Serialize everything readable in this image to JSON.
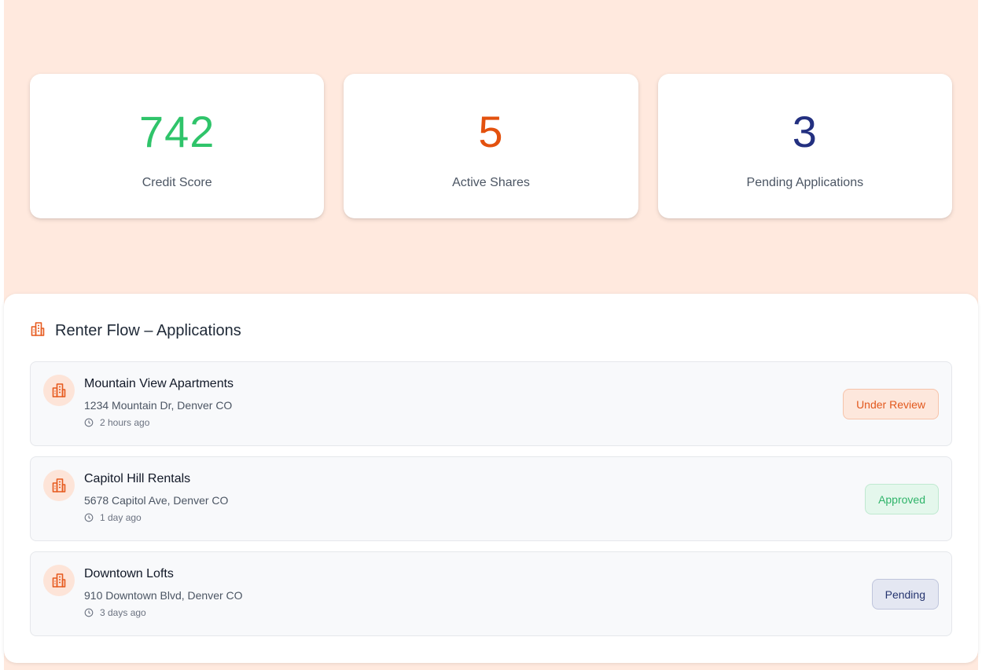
{
  "colors": {
    "accent": "#e65a1e",
    "page_background": "#ffe9de",
    "credit_score": "#2fc46a",
    "active_shares": "#e3510e",
    "pending_applications": "#233080"
  },
  "stats": [
    {
      "value": "742",
      "label": "Credit Score"
    },
    {
      "value": "5",
      "label": "Active Shares"
    },
    {
      "value": "3",
      "label": "Pending Applications"
    }
  ],
  "applications_panel": {
    "title": "Renter Flow – Applications",
    "icon": "building-icon",
    "items": [
      {
        "name": "Mountain View Apartments",
        "address": "1234 Mountain Dr, Denver CO",
        "time": "2 hours ago",
        "status": "Under Review",
        "icon": "building-icon"
      },
      {
        "name": "Capitol Hill Rentals",
        "address": "5678 Capitol Ave, Denver CO",
        "time": "1 day ago",
        "status": "Approved",
        "icon": "building-icon"
      },
      {
        "name": "Downtown Lofts",
        "address": "910 Downtown Blvd, Denver CO",
        "time": "3 days ago",
        "status": "Pending",
        "icon": "building-icon"
      }
    ]
  }
}
